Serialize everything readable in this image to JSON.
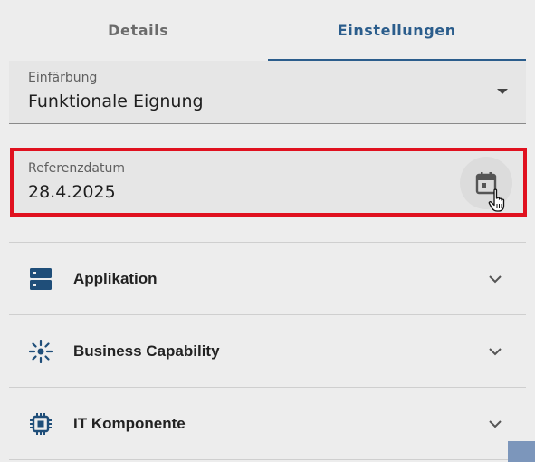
{
  "tabs": [
    {
      "label": "Details",
      "active": false
    },
    {
      "label": "Einstellungen",
      "active": true
    }
  ],
  "coloring": {
    "label": "Einfärbung",
    "value": "Funktionale Eignung"
  },
  "reference_date": {
    "label": "Referenzdatum",
    "value": "28.4.2025"
  },
  "sections": [
    {
      "label": "Applikation",
      "icon": "application-icon"
    },
    {
      "label": "Business Capability",
      "icon": "business-capability-icon"
    },
    {
      "label": "IT Komponente",
      "icon": "it-component-icon"
    }
  ],
  "colors": {
    "accent": "#2b5d8c",
    "highlight": "#e0111f",
    "icon": "#1f4e79"
  }
}
